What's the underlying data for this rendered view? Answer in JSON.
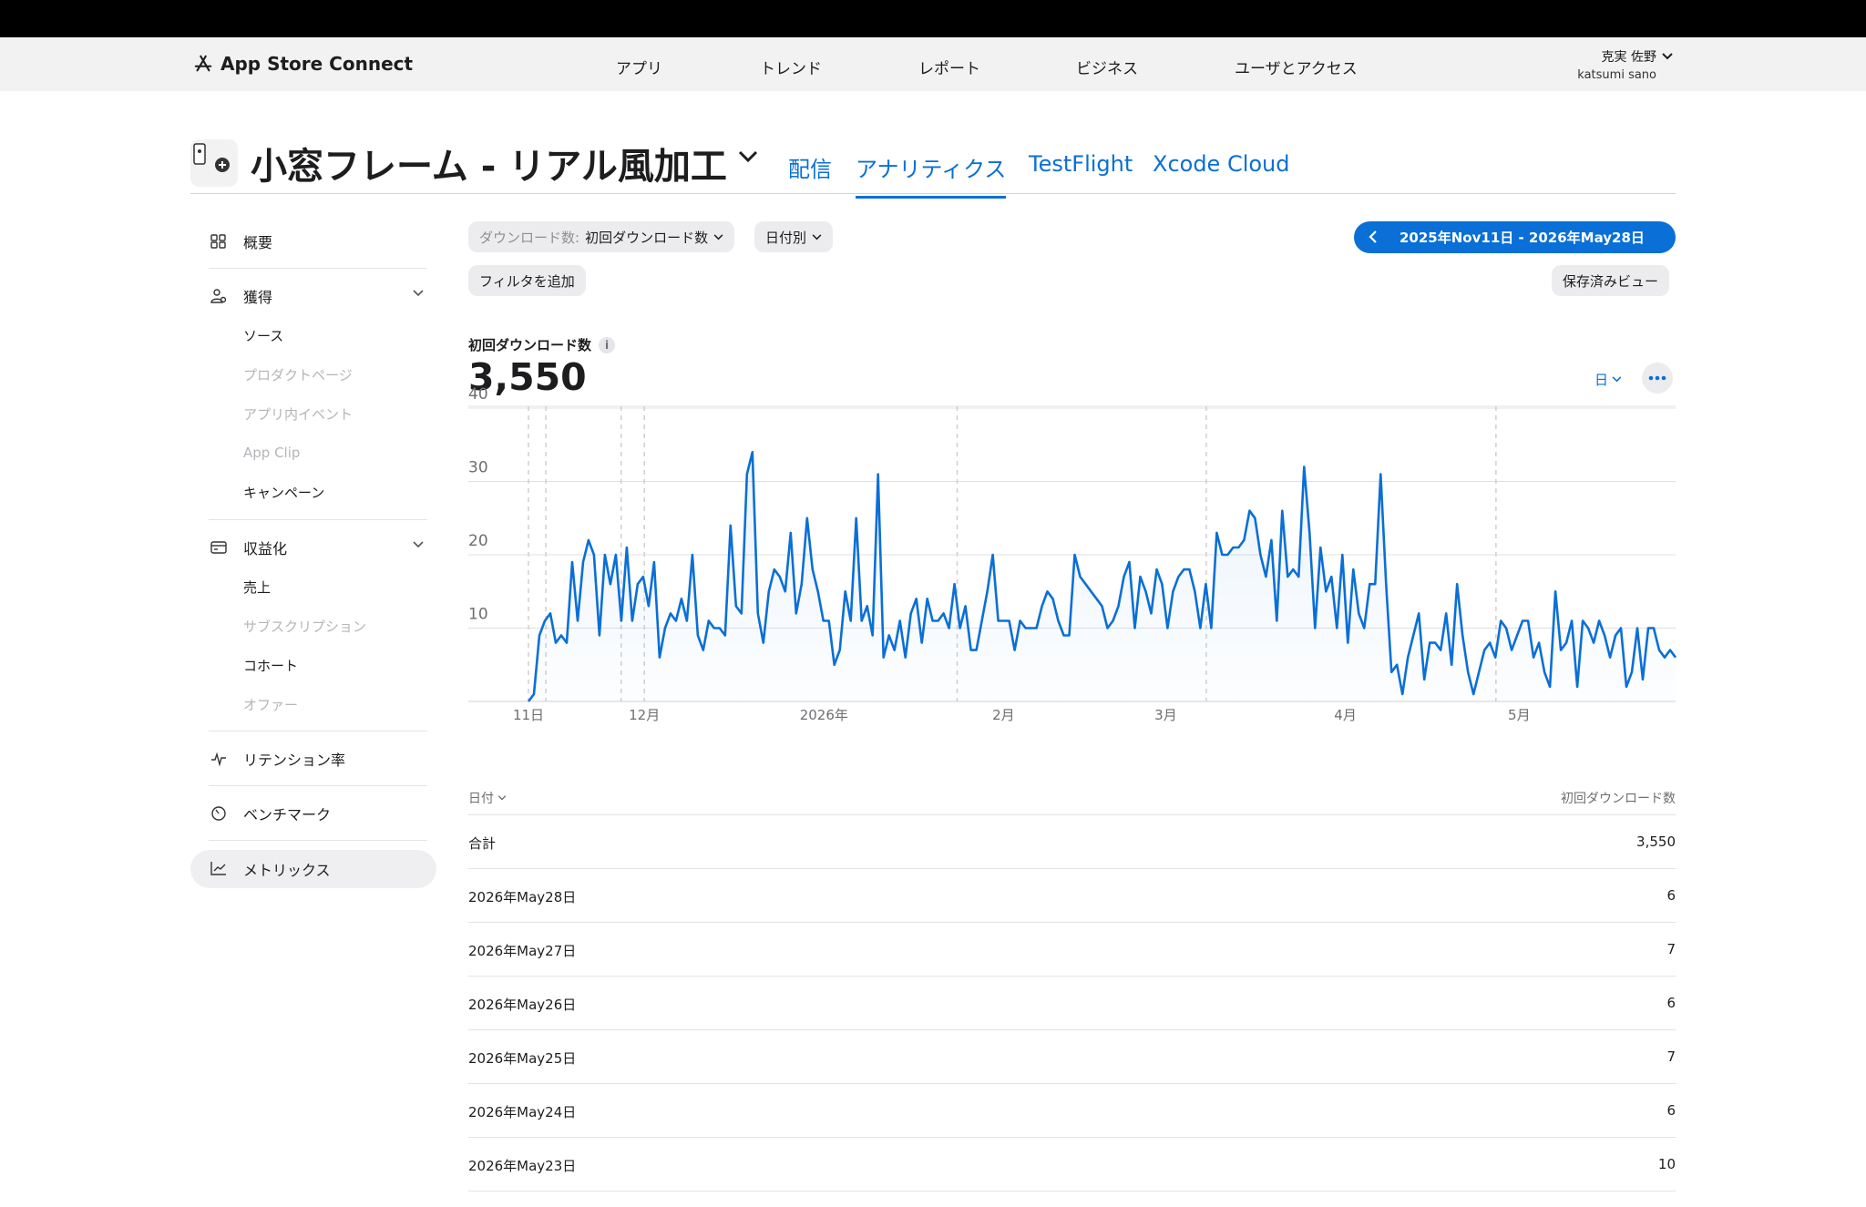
{
  "header": {
    "brand": "App Store Connect",
    "nav": [
      "アプリ",
      "トレンド",
      "レポート",
      "ビジネス",
      "ユーザとアクセス"
    ],
    "user_name": "克実 佐野",
    "user_id": "katsumi sano"
  },
  "app": {
    "title": "小窓フレーム - リアル風加工",
    "tabs": [
      "配信",
      "アナリティクス",
      "TestFlight",
      "Xcode Cloud"
    ],
    "active_tab": "アナリティクス"
  },
  "sidebar": {
    "overview": "概要",
    "acquisition": "獲得",
    "acquisition_items": [
      "ソース",
      "プロダクトページ",
      "アプリ内イベント",
      "App Clip",
      "キャンペーン"
    ],
    "monetization": "収益化",
    "monetization_items": [
      "売上",
      "サブスクリプション",
      "コホート",
      "オファー"
    ],
    "retention": "リテンション率",
    "benchmark": "ベンチマーク",
    "metrics": "メトリックス"
  },
  "filters": {
    "metric_prefix": "ダウンロード数:",
    "metric_value": "初回ダウンロード数",
    "grouping": "日付別",
    "add_filter": "フィルタを追加",
    "date_range": "2025年Nov11日 - 2026年May28日",
    "saved_views": "保存済みビュー"
  },
  "summary": {
    "label": "初回ダウンロード数",
    "value": "3,550",
    "granularity": "日",
    "info_glyph": "i"
  },
  "chart_data": {
    "type": "area",
    "ylim": [
      0,
      40
    ],
    "yticks": [
      "10",
      "20",
      "30",
      "40"
    ],
    "xtick_labels": [
      "11日",
      "12月",
      "2026年",
      "2月",
      "3月",
      "4月",
      "5月"
    ],
    "x_start": "2025-11-11",
    "x_end": "2026-05-28",
    "color": "#0a6fd6",
    "values": [
      0,
      1,
      9,
      11,
      12,
      8,
      9,
      8,
      19,
      11,
      19,
      22,
      20,
      9,
      20,
      16,
      20,
      11,
      21,
      11,
      16,
      17,
      13,
      19,
      6,
      10,
      12,
      11,
      14,
      11,
      20,
      9,
      7,
      11,
      10,
      10,
      9,
      24,
      13,
      12,
      31,
      34,
      12,
      8,
      15,
      18,
      17,
      15,
      23,
      12,
      16,
      25,
      18,
      15,
      11,
      11,
      5,
      7,
      15,
      11,
      25,
      11,
      13,
      9,
      31,
      6,
      9,
      7,
      11,
      6,
      12,
      14,
      8,
      14,
      11,
      11,
      12,
      10,
      16,
      10,
      13,
      7,
      7,
      11,
      15,
      20,
      11,
      11,
      11,
      7,
      11,
      10,
      10,
      10,
      13,
      15,
      14,
      11,
      9,
      9,
      20,
      17,
      16,
      15,
      14,
      13,
      10,
      11,
      13,
      17,
      19,
      10,
      17,
      15,
      12,
      18,
      16,
      10,
      15,
      17,
      18,
      18,
      15,
      10,
      16,
      10,
      23,
      20,
      20,
      21,
      21,
      22,
      26,
      25,
      20,
      17,
      22,
      11,
      26,
      17,
      18,
      17,
      32,
      23,
      10,
      21,
      15,
      17,
      10,
      20,
      8,
      18,
      12,
      10,
      16,
      16,
      31,
      16,
      4,
      5,
      1,
      6,
      9,
      12,
      3,
      8,
      8,
      7,
      12,
      5,
      16,
      9,
      4,
      1,
      4,
      7,
      8,
      6,
      11,
      10,
      7,
      9,
      11,
      11,
      6,
      8,
      4,
      2,
      15,
      7,
      8,
      11,
      2,
      11,
      10,
      8,
      11,
      9,
      6,
      9,
      10,
      2,
      4,
      10,
      3,
      10,
      10,
      7,
      6,
      7,
      6
    ]
  },
  "table": {
    "col_date": "日付",
    "col_value": "初回ダウンロード数",
    "rows": [
      {
        "date": "合計",
        "value": "3,550"
      },
      {
        "date": "2026年May28日",
        "value": "6"
      },
      {
        "date": "2026年May27日",
        "value": "7"
      },
      {
        "date": "2026年May26日",
        "value": "6"
      },
      {
        "date": "2026年May25日",
        "value": "7"
      },
      {
        "date": "2026年May24日",
        "value": "6"
      },
      {
        "date": "2026年May23日",
        "value": "10"
      }
    ]
  }
}
